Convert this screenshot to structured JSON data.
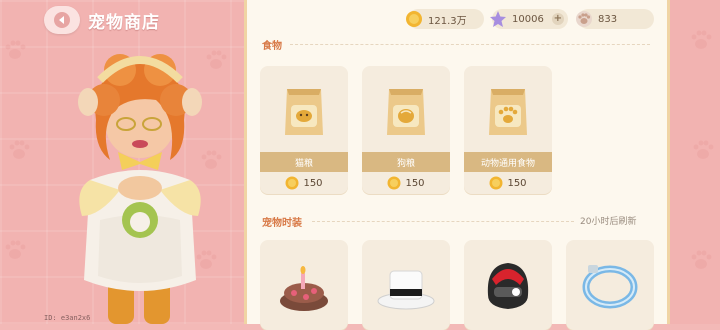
{
  "header": {
    "title": "宠物商店",
    "back_icon": "back-arrow-icon"
  },
  "currencies": [
    {
      "icon": "gold-coin-icon",
      "value": "121.3万",
      "color": "#f2b531"
    },
    {
      "icon": "purple-star-icon",
      "value": "10006",
      "color": "#a78ee0",
      "has_plus": true,
      "plus_label": "+"
    },
    {
      "icon": "paw-token-icon",
      "value": "833",
      "color": "#c9a08c"
    }
  ],
  "sections": [
    {
      "title": "食物",
      "items": [
        {
          "name": "猫粮",
          "price": "150",
          "icon": "cat-food-bag-icon"
        },
        {
          "name": "狗粮",
          "price": "150",
          "icon": "dog-food-bag-icon"
        },
        {
          "name": "动物通用食物",
          "price": "150",
          "icon": "animal-food-bag-icon"
        }
      ]
    },
    {
      "title": "宠物时装",
      "refresh_text": "20小时后刷新",
      "items": [
        {
          "name": "",
          "icon": "birthday-cake-hat-icon"
        },
        {
          "name": "",
          "icon": "white-top-hat-icon"
        },
        {
          "name": "",
          "icon": "red-helmet-icon"
        },
        {
          "name": "",
          "icon": "blue-collar-icon"
        }
      ]
    }
  ],
  "debug": "ID: e3an2x6",
  "colors": {
    "accent": "#d87a48",
    "panel_bg": "#fdf8ee",
    "name_bar": "#d9b882",
    "pink_bg": "#f2b3b1"
  }
}
